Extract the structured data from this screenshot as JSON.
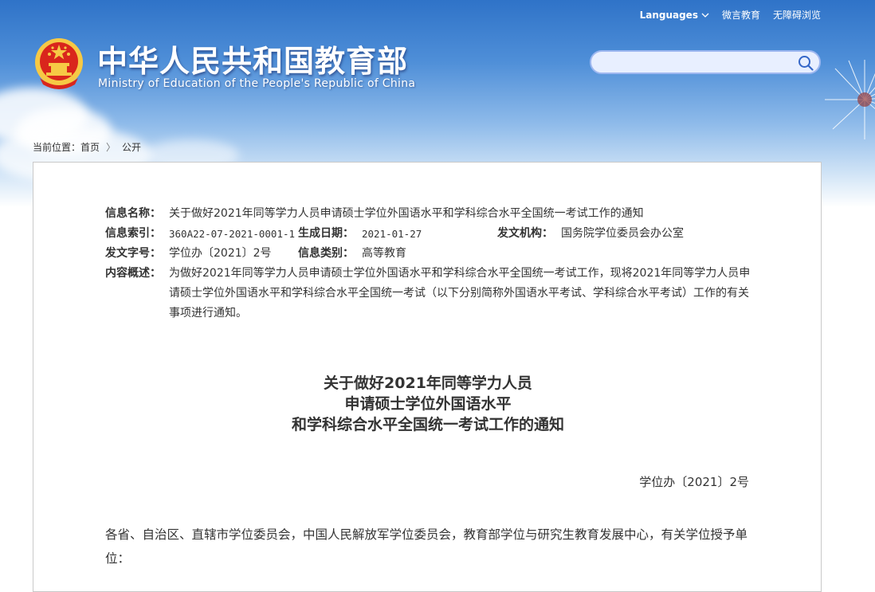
{
  "header": {
    "title_cn": "中华人民共和国教育部",
    "title_en": "Ministry of Education of the People's Republic of China",
    "nav": {
      "languages": "Languages",
      "weibo": "微言教育",
      "accessibility": "无障碍浏览"
    },
    "search": {
      "value": "",
      "placeholder": ""
    }
  },
  "breadcrumb": {
    "prefix": "当前位置：",
    "home": "首页",
    "separator": "〉",
    "current": "公开"
  },
  "meta": {
    "name_label": "信息名称：",
    "name_value": "关于做好2021年同等学力人员申请硕士学位外国语水平和学科综合水平全国统一考试工作的通知",
    "index_label": "信息索引：",
    "index_value": "360A22-07-2021-0001-1",
    "date_label": "生成日期：",
    "date_value": "2021-01-27",
    "org_label": "发文机构：",
    "org_value": "国务院学位委员会办公室",
    "docnum_label": "发文字号：",
    "docnum_value": "学位办〔2021〕2号",
    "category_label": "信息类别：",
    "category_value": "高等教育",
    "summary_label": "内容概述：",
    "summary_value": "为做好2021年同等学力人员申请硕士学位外国语水平和学科综合水平全国统一考试工作，现将2021年同等学力人员申请硕士学位外国语水平和学科综合水平全国统一考试（以下分别简称外国语水平考试、学科综合水平考试）工作的有关事项进行通知。"
  },
  "document": {
    "title_lines": [
      "关于做好2021年同等学力人员",
      "申请硕士学位外国语水平",
      "和学科综合水平全国统一考试工作的通知"
    ],
    "doc_number": "学位办〔2021〕2号",
    "addressee": "各省、自治区、直辖市学位委员会，中国人民解放军学位委员会，教育部学位与研究生教育发展中心，有关学位授予单位："
  },
  "colors": {
    "sky_top": "#2f73c8",
    "sky_bottom": "#d4e6f7",
    "emblem_red": "#d9261c",
    "emblem_gold": "#f6c945",
    "search_border": "#9db7f0"
  }
}
